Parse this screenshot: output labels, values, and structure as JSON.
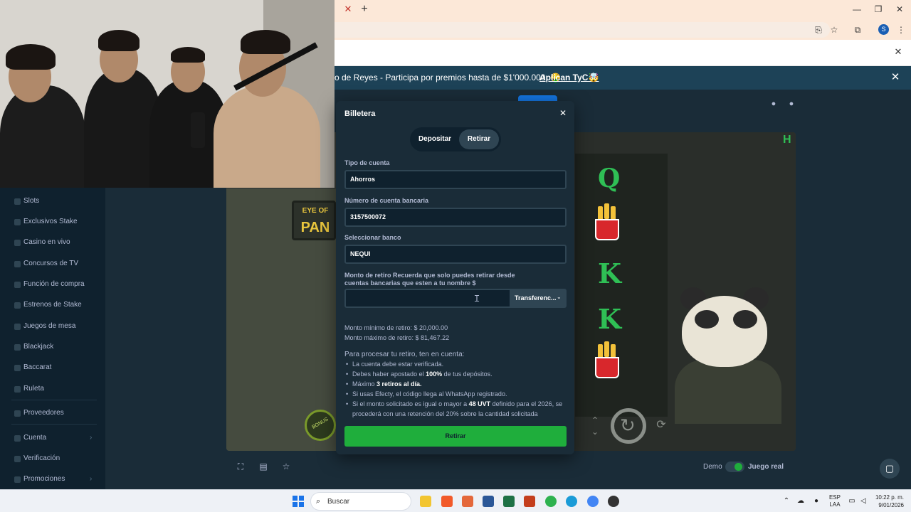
{
  "browser": {
    "tab_close_icon": "close-icon",
    "new_tab_icon": "plus-icon",
    "window_controls": [
      "minimize-icon",
      "restore-icon",
      "close-icon"
    ],
    "toolbar_icons": [
      "cast-icon",
      "star-icon",
      "extensions-icon",
      "menu-icon"
    ],
    "profile_initial": "S"
  },
  "promo": {
    "text": "o de Reyes - Participa por premios hasta de $1'000.000. 🤑",
    "link": "Aplican TyC🤯"
  },
  "sidebar": {
    "items": [
      {
        "label": "Slots"
      },
      {
        "label": "Exclusivos Stake"
      },
      {
        "label": "Casino en vivo"
      },
      {
        "label": "Concursos de TV"
      },
      {
        "label": "Función de compra"
      },
      {
        "label": "Estrenos de Stake"
      },
      {
        "label": "Juegos de mesa"
      },
      {
        "label": "Blackjack"
      },
      {
        "label": "Baccarat"
      },
      {
        "label": "Ruleta"
      },
      {
        "label": "Proveedores"
      },
      {
        "label": "Cuenta"
      },
      {
        "label": "Verificación"
      },
      {
        "label": "Promociones"
      }
    ]
  },
  "game": {
    "sign_top": "EYE OF",
    "sign_bottom": "PAN",
    "bonus_label": "BONUS",
    "logo": "H",
    "symbols": [
      "Q",
      "K",
      "K"
    ]
  },
  "game_bar": {
    "demo_label": "Demo",
    "real_label": "Juego real"
  },
  "modal": {
    "title": "Billetera",
    "tabs": [
      "Depositar",
      "Retirar"
    ],
    "active_tab": "Retirar",
    "account_type_label": "Tipo de cuenta",
    "account_type_value": "Ahorros",
    "account_number_label": "Número de cuenta bancaria",
    "account_number_value": "3157500072",
    "bank_label": "Seleccionar banco",
    "bank_value": "NEQUI",
    "amount_label": "Monto de retiro Recuerda que solo puedes retirar desde cuentas bancarias que esten a tu nombre $",
    "amount_value": "",
    "method_value": "Transferenc...",
    "min_amount": "Monto mínimo de retiro: $ 20,000.00",
    "max_amount": "Monto máximo de retiro: $ 81,467.22",
    "rules_title": "Para procesar tu retiro, ten en cuenta:",
    "rules": [
      {
        "pre": "La cuenta debe estar verificada.",
        "bold": "",
        "post": ""
      },
      {
        "pre": "Debes haber apostado el ",
        "bold": "100%",
        "post": " de tus depósitos."
      },
      {
        "pre": "Máximo ",
        "bold": "3 retiros al día.",
        "post": ""
      },
      {
        "pre": "Si usas Efecty, el código llega al WhatsApp registrado.",
        "bold": "",
        "post": ""
      },
      {
        "pre": "Si el monto solicitado es igual o mayor a ",
        "bold": "48 UVT",
        "post": " definido para el 2026, se procederá con una retención del 20% sobre la cantidad solicitada"
      }
    ],
    "submit_label": "Retirar"
  },
  "taskbar": {
    "search_placeholder": "Buscar",
    "lang_top": "ESP",
    "lang_bottom": "LAA",
    "time": "10:22 p. m.",
    "date": "9/01/2026"
  }
}
